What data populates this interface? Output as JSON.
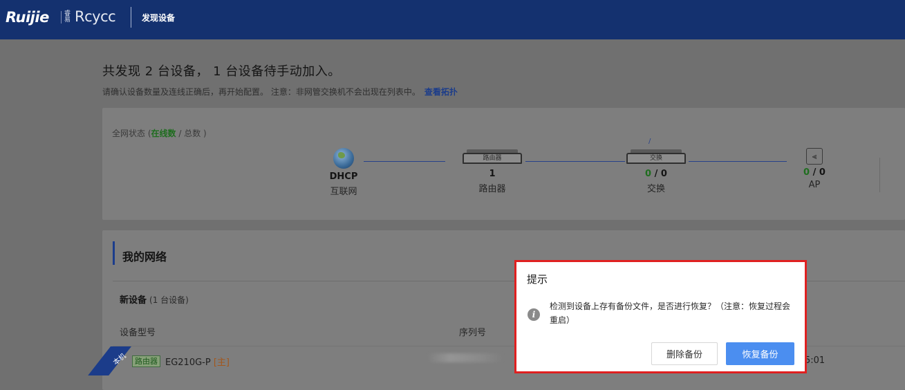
{
  "header": {
    "logo": "Ruijie",
    "logo_mark": "睿易",
    "brand2": "Rcycc",
    "page_name": "发现设备"
  },
  "summary": {
    "title": "共发现 2 台设备， 1 台设备待手动加入。",
    "note": "请确认设备数量及连线正确后，再开始配置。 注意：非网管交换机不会出现在列表中。",
    "topology_link": "查看拓扑"
  },
  "status": {
    "label_prefix": "全网状态 (",
    "label_online": "在线数",
    "label_suffix": "/ 总数 )",
    "internet": {
      "value": "DHCP",
      "label": "互联网"
    },
    "router": {
      "icon_text": "路由器",
      "value": "1",
      "label": "路由器"
    },
    "switch": {
      "icon_text": "交换",
      "online": "0",
      "total": "/ 0",
      "label": "交换"
    },
    "ap": {
      "online": "0",
      "total": "/ 0",
      "label": "AP"
    },
    "slash": "/"
  },
  "network": {
    "title": "我的网络",
    "new_devices_label": "新设备",
    "new_devices_count": "(1 台设备)",
    "columns": {
      "model": "设备型号",
      "serial": "序列号"
    },
    "row": {
      "ribbon": "本机",
      "type_tag": "路由器",
      "model": "EG210G-P",
      "role": "[主]",
      "time_fragment": "5:01"
    }
  },
  "dialog": {
    "title": "提示",
    "message": "检测到设备上存有备份文件，是否进行恢复？（注意：恢复过程会重启）",
    "delete_button": "删除备份",
    "restore_button": "恢复备份",
    "accent": "#4b8ef0",
    "highlight": "#e02020"
  }
}
